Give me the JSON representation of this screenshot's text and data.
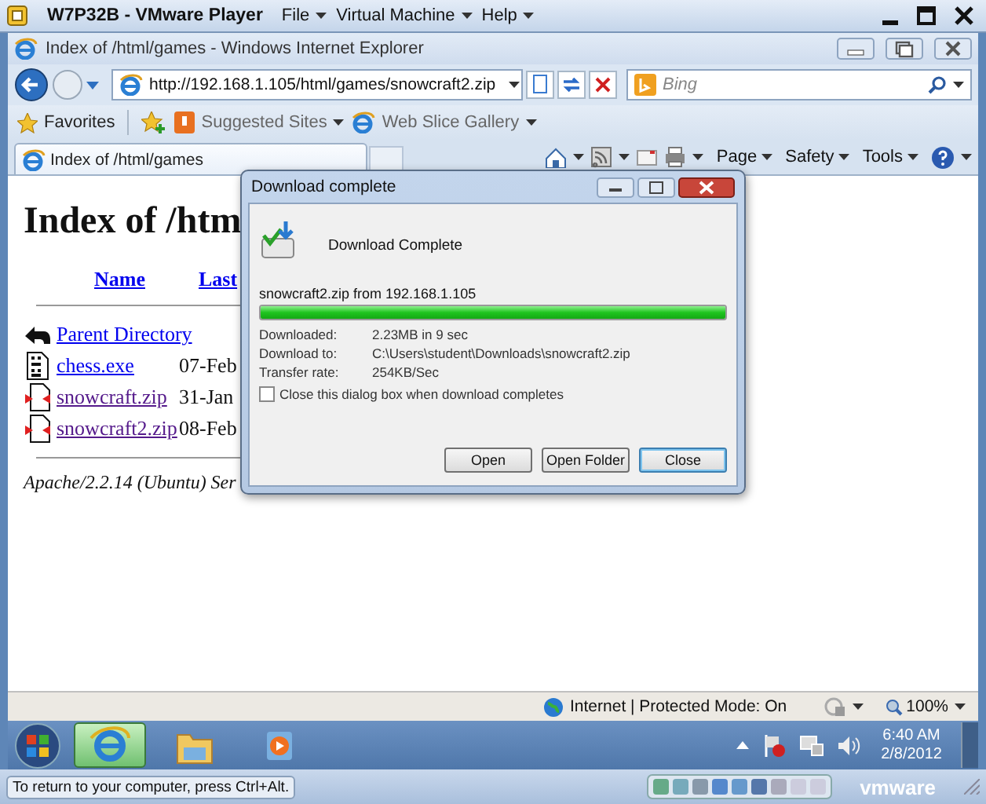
{
  "vmware": {
    "title": "W7P32B - VMware Player",
    "menus": [
      {
        "label": "File"
      },
      {
        "label": "Virtual Machine"
      },
      {
        "label": "Help"
      }
    ],
    "hint": "To return to your computer, press Ctrl+Alt.",
    "logo": "vmware"
  },
  "browser": {
    "title": "Index of /html/games - Windows Internet Explorer",
    "address": "http://192.168.1.105/html/games/snowcraft2.zip",
    "search_placeholder": "Bing",
    "favorites": [
      {
        "label": "Favorites",
        "kind": "favorites"
      },
      {
        "label": "Suggested Sites",
        "kind": "suggested"
      },
      {
        "label": "Web Slice Gallery",
        "kind": "webslice"
      }
    ],
    "tabs": [
      {
        "label": "Index of /html/games",
        "selected": true
      }
    ],
    "commands": [
      {
        "label": "Page"
      },
      {
        "label": "Safety"
      },
      {
        "label": "Tools"
      }
    ],
    "status": "Internet | Protected Mode: On",
    "zoom": "100%"
  },
  "page": {
    "heading": "Index of /htm",
    "columns": [
      "Name",
      "Last"
    ],
    "rows": [
      {
        "name": "Parent Directory",
        "kind": "parent",
        "visited": false
      },
      {
        "name": "chess.exe",
        "kind": "binary",
        "visited": false,
        "date": "07-Feb"
      },
      {
        "name": "snowcraft.zip",
        "kind": "archive",
        "visited": true,
        "date": "31-Jan"
      },
      {
        "name": "snowcraft2.zip",
        "kind": "archive",
        "visited": true,
        "date": "08-Feb"
      }
    ],
    "footer": "Apache/2.2.14 (Ubuntu) Ser"
  },
  "dialog": {
    "title": "Download complete",
    "heading": "Download Complete",
    "source": "snowcraft2.zip from 192.168.1.105",
    "level": 1,
    "details": [
      {
        "label": "Downloaded:",
        "value": "2.23MB in 9 sec"
      },
      {
        "label": "Download to:",
        "value": "C:\\Users\\student\\Downloads\\snowcraft2.zip"
      },
      {
        "label": "Transfer rate:",
        "value": "254KB/Sec"
      }
    ],
    "close_when_done": {
      "label": "Close this dialog box when download completes",
      "checked": false
    },
    "buttons": [
      {
        "label": "Open",
        "default": false
      },
      {
        "label": "Open Folder",
        "default": false
      },
      {
        "label": "Close",
        "default": true
      }
    ]
  },
  "taskbar": {
    "apps": [
      {
        "kind": "browser",
        "selected": true
      },
      {
        "kind": "folder",
        "selected": false
      },
      {
        "kind": "media",
        "selected": false
      }
    ],
    "time": "6:40 AM",
    "date": "2/8/2012"
  }
}
